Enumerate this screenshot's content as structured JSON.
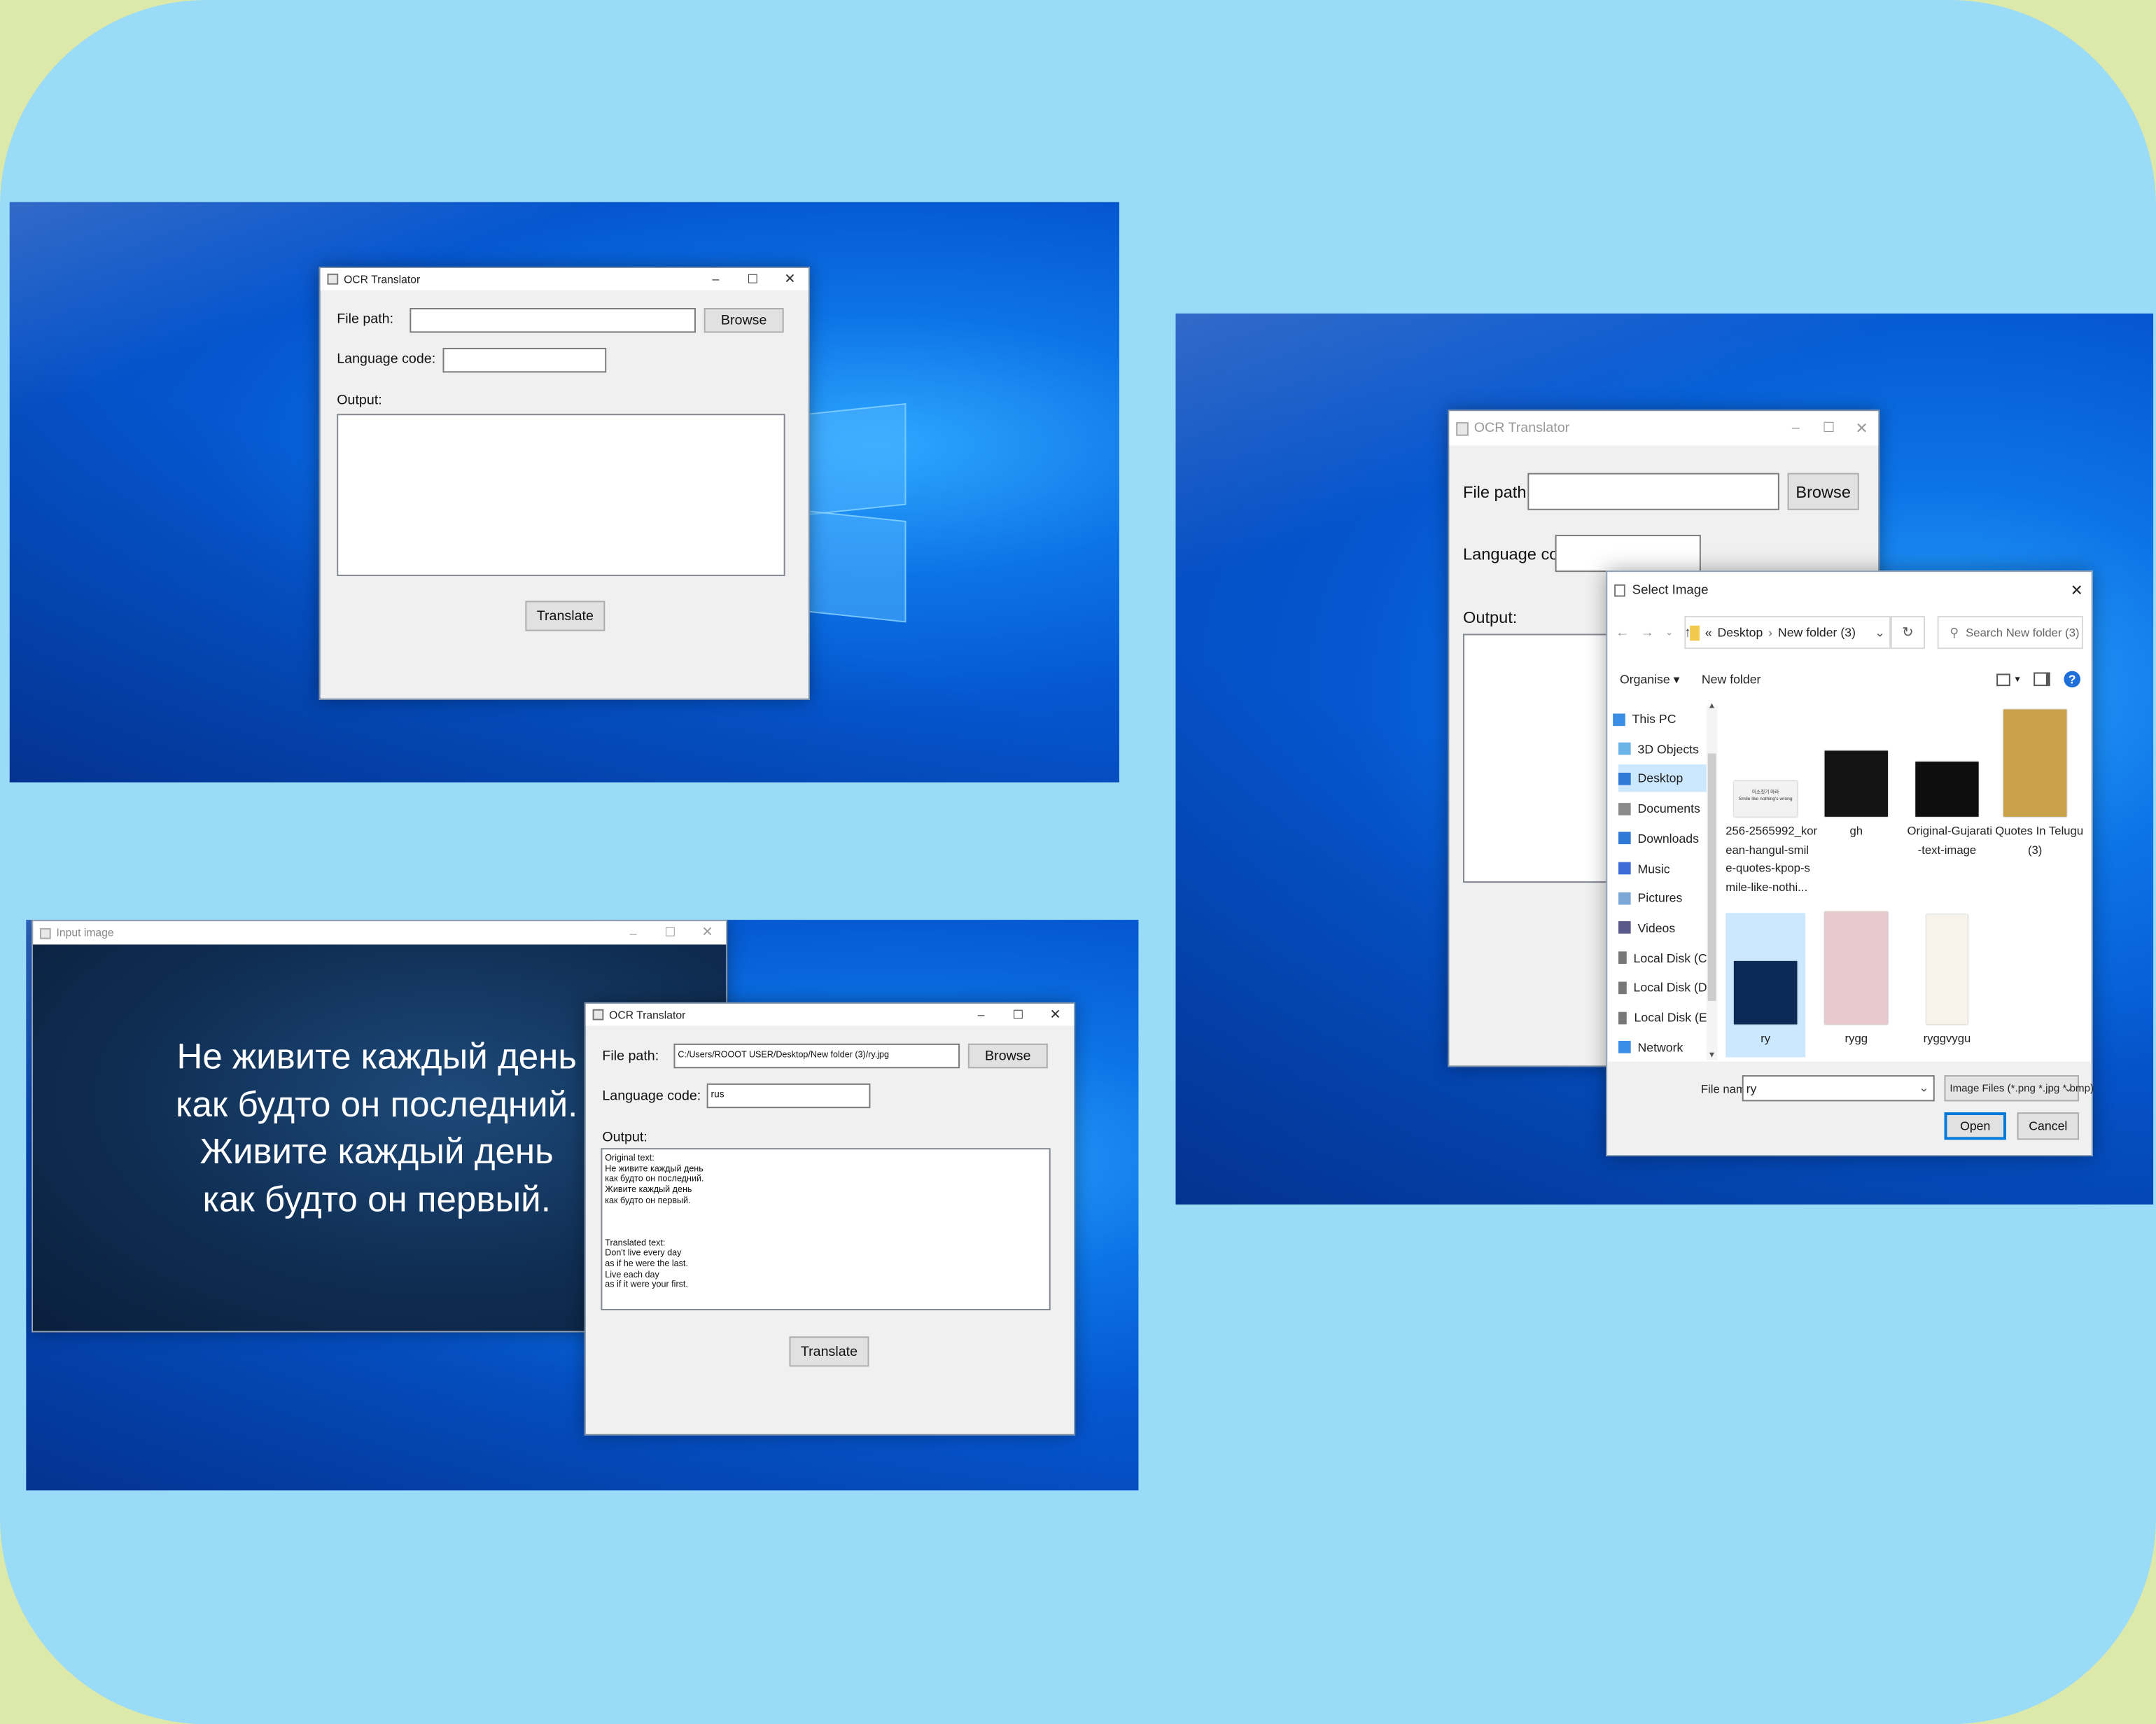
{
  "ocr_app": {
    "title": "OCR Translator",
    "file_path_label": "File path:",
    "browse_label": "Browse",
    "language_code_label": "Language code:",
    "output_label": "Output:",
    "translate_label": "Translate"
  },
  "panel2": {
    "input_window_title": "Input image",
    "image_text": "Не живите каждый день\nкак будто он последний.\nЖивите каждый день\nкак будто он первый.",
    "file_path_value": "C:/Users/ROOOT USER/Desktop/New folder (3)/ry.jpg",
    "language_code_value": "rus",
    "output_text": "Original text:\nНе живите каждый день\nкак будто он последний.\nЖивите каждый день\nкак будто он первый.\n\n\n\nTranslated text:\nDon't live every day\nas if he were the last.\nLive each day\nas if it were your first."
  },
  "dialog": {
    "title": "Select Image",
    "breadcrumb_prefix": "«",
    "breadcrumb": [
      "Desktop",
      "New folder (3)"
    ],
    "search_placeholder": "Search New folder (3)",
    "organise_label": "Organise ▾",
    "new_folder_label": "New folder",
    "help_label": "?",
    "sidebar": [
      {
        "label": "This PC",
        "icon": "computer-icon"
      },
      {
        "label": "3D Objects",
        "icon": "cube-icon"
      },
      {
        "label": "Desktop",
        "icon": "desktop-icon",
        "selected": true
      },
      {
        "label": "Documents",
        "icon": "document-icon"
      },
      {
        "label": "Downloads",
        "icon": "download-icon"
      },
      {
        "label": "Music",
        "icon": "music-icon"
      },
      {
        "label": "Pictures",
        "icon": "pictures-icon"
      },
      {
        "label": "Videos",
        "icon": "video-icon"
      },
      {
        "label": "Local Disk (C:)",
        "icon": "drive-icon"
      },
      {
        "label": "Local Disk (D:)",
        "icon": "drive-icon"
      },
      {
        "label": "Local Disk (E:)",
        "icon": "drive-icon"
      },
      {
        "label": "Network",
        "icon": "network-icon"
      }
    ],
    "files": [
      {
        "name": "256-2565992_korean-hangul-smile-quotes-kpop-smile-like-nothi...",
        "display": "256-2565992_kor\nean-hangul-smil\ne-quotes-kpop-s\nmile-like-nothi...",
        "thumb_color": "#f2f2f2",
        "thumb_caption": "미소짓기 마라\nSmile like nothing's wrong"
      },
      {
        "name": "gh",
        "display": "gh",
        "thumb_color": "#141414"
      },
      {
        "name": "Original-Gujarati-text-image",
        "display": "Original-Gujarati\n-text-image",
        "thumb_color": "#0e0e0e"
      },
      {
        "name": "Quotes In Telugu (3)",
        "display": "Quotes In Telugu\n(3)",
        "thumb_color": "#c9a24a"
      },
      {
        "name": "ry",
        "display": "ry",
        "thumb_color": "#0b2a55",
        "selected": true
      },
      {
        "name": "rygg",
        "display": "rygg",
        "thumb_color": "#e7c9cb"
      },
      {
        "name": "ryggvygu",
        "display": "ryggvygu",
        "thumb_color": "#f7f3ea"
      }
    ],
    "file_name_label": "File name:",
    "file_name_value": "ry",
    "filter_value": "Image Files (*.png *.jpg *.bmp)",
    "open_label": "Open",
    "cancel_label": "Cancel"
  }
}
